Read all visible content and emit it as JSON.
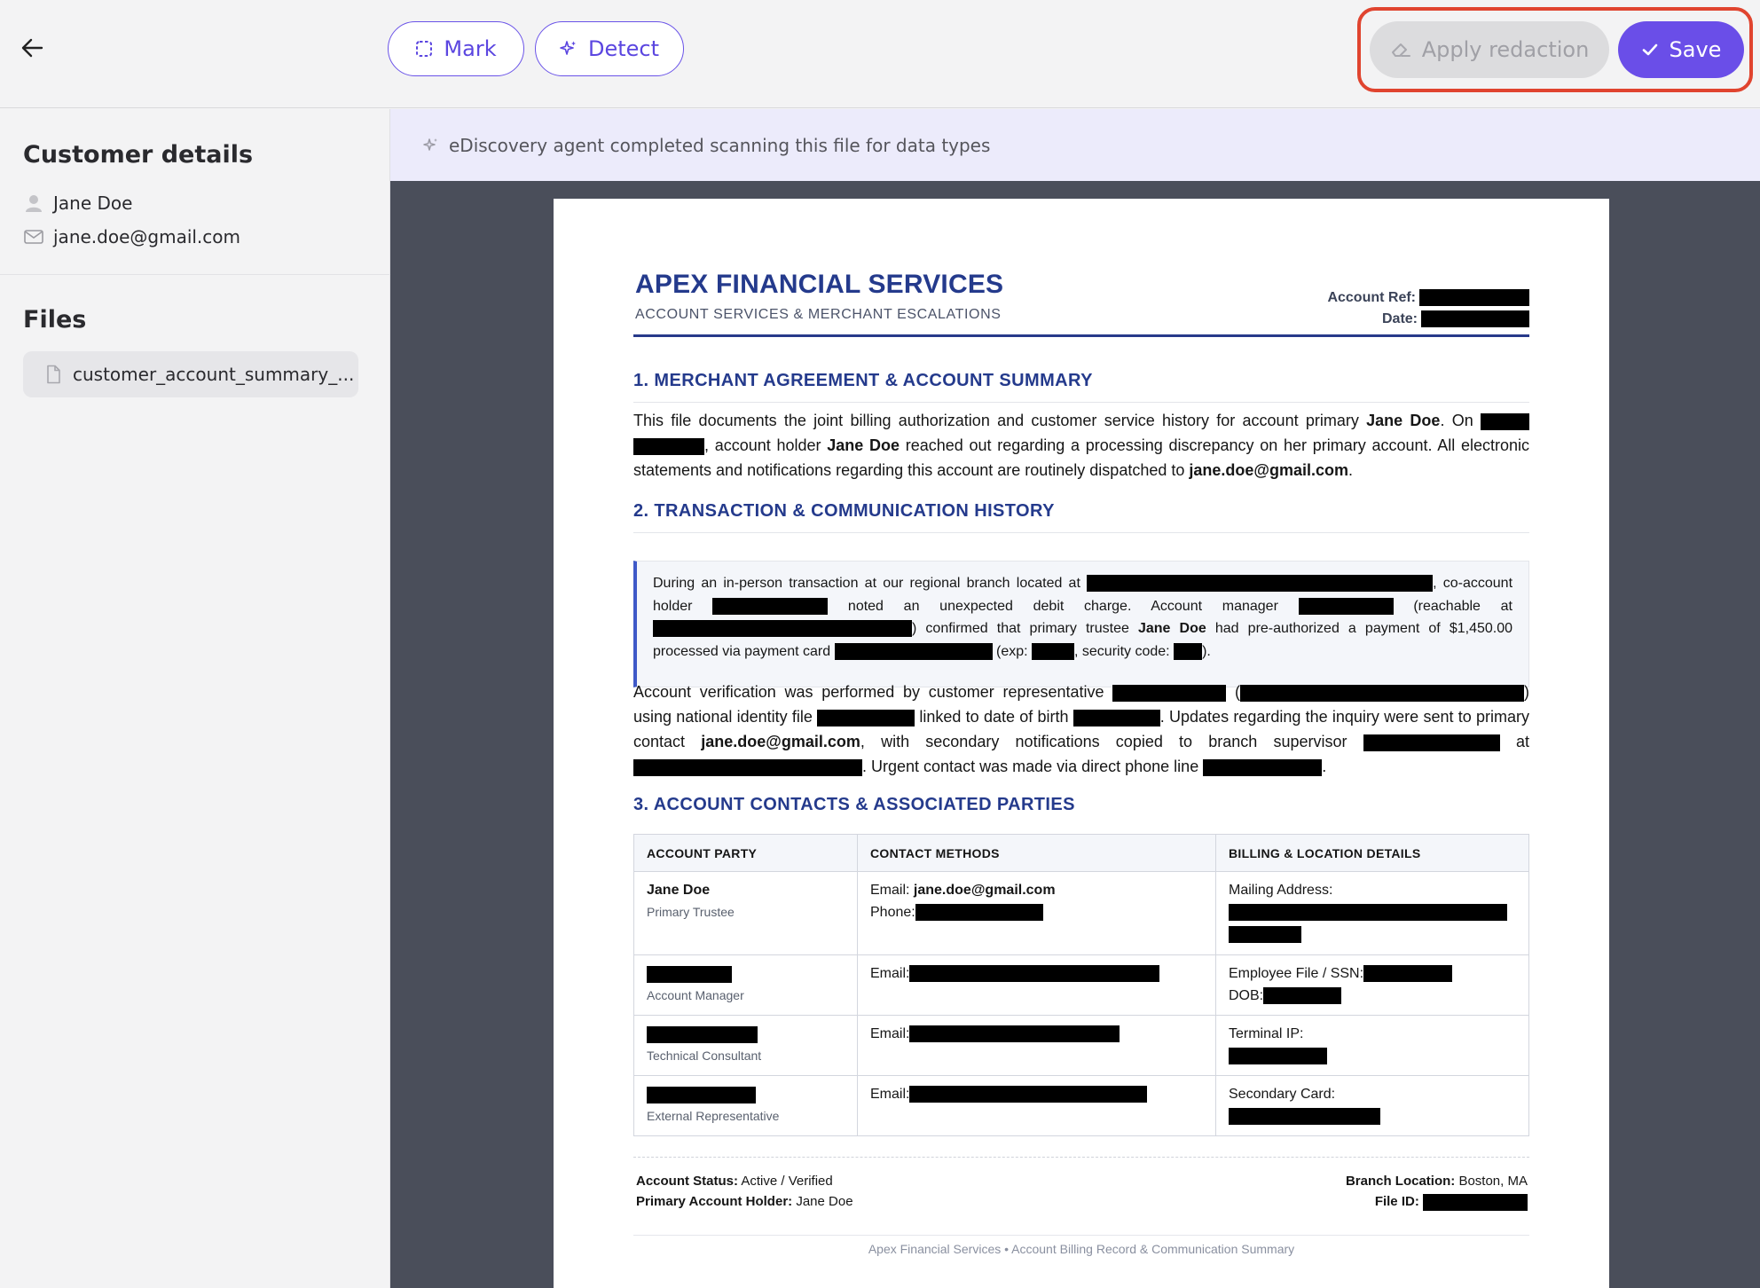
{
  "toolbar": {
    "back_icon": "arrow-left-icon",
    "mark_label": "Mark",
    "detect_label": "Detect",
    "apply_label": "Apply redaction",
    "save_label": "Save"
  },
  "colors": {
    "accent": "#6a4ee8",
    "highlight_frame": "#e0442f",
    "doc_heading": "#243a8c"
  },
  "sidebar": {
    "customer_title": "Customer details",
    "customer_name": "Jane Doe",
    "customer_email": "jane.doe@gmail.com",
    "files_title": "Files",
    "files": [
      {
        "name": "customer_account_summary_..."
      }
    ]
  },
  "banner": {
    "text": "eDiscovery agent completed scanning this file for data types"
  },
  "document": {
    "company": "APEX FINANCIAL SERVICES",
    "subtitle": "ACCOUNT SERVICES & MERCHANT ESCALATIONS",
    "account_ref_label": "Account Ref:",
    "date_label": "Date:",
    "section1": {
      "heading": "1. MERCHANT AGREEMENT & ACCOUNT SUMMARY",
      "t1": "This file documents the joint billing authorization and customer service history for account primary ",
      "name1": "Jane Doe",
      "t2": ". On ",
      "t3": ", account holder ",
      "name2": "Jane Doe",
      "t4": " reached out regarding a processing discrepancy on her primary account. All electronic statements and notifications regarding this account are routinely dispatched to ",
      "email": "jane.doe@gmail.com",
      "t5": "."
    },
    "section2": {
      "heading": "2. TRANSACTION & COMMUNICATION HISTORY",
      "c1": "During an in-person transaction at our regional branch located at ",
      "c2": ", co-account holder ",
      "c3": " noted an unexpected debit charge. Account manager ",
      "c4": " (reachable at ",
      "c5": ") confirmed that primary trustee ",
      "c_name": "Jane Doe",
      "c6": " had pre-authorized a payment of $1,450.00 processed via payment card ",
      "c7": " (exp: ",
      "c8": ", security code: ",
      "c9": ").",
      "p1": "Account verification was performed by customer representative ",
      "p2": " (",
      "p3": ") using national identity file ",
      "p4": " linked to date of birth ",
      "p5": ". Updates regarding the inquiry were sent to primary contact ",
      "p_email": "jane.doe@gmail.com",
      "p6": ", with secondary notifications copied to branch supervisor ",
      "p7": " at ",
      "p8": ". Urgent contact was made via direct phone line ",
      "p9": "."
    },
    "section3": {
      "heading": "3. ACCOUNT CONTACTS & ASSOCIATED PARTIES",
      "columns": [
        "ACCOUNT PARTY",
        "CONTACT METHODS",
        "BILLING & LOCATION DETAILS"
      ],
      "rows": [
        {
          "party": "Jane Doe",
          "role": "Primary Trustee",
          "email_label": "Email:",
          "email": "jane.doe@gmail.com",
          "phone_label": "Phone:",
          "detail_label": "Mailing Address:"
        },
        {
          "role": "Account Manager",
          "email_label": "Email:",
          "detail_label": "Employee File / SSN:",
          "detail_label2": "DOB:"
        },
        {
          "role": "Technical Consultant",
          "email_label": "Email:",
          "detail_label": "Terminal IP:"
        },
        {
          "role": "External Representative",
          "email_label": "Email:",
          "detail_label": "Secondary Card:"
        }
      ]
    },
    "footer": {
      "status_label": "Account Status:",
      "status_value": "Active / Verified",
      "holder_label": "Primary Account Holder:",
      "holder_value": "Jane Doe",
      "branch_label": "Branch Location:",
      "branch_value": "Boston, MA",
      "file_id_label": "File ID:",
      "note": "Apex Financial Services • Account Billing Record & Communication Summary"
    }
  }
}
